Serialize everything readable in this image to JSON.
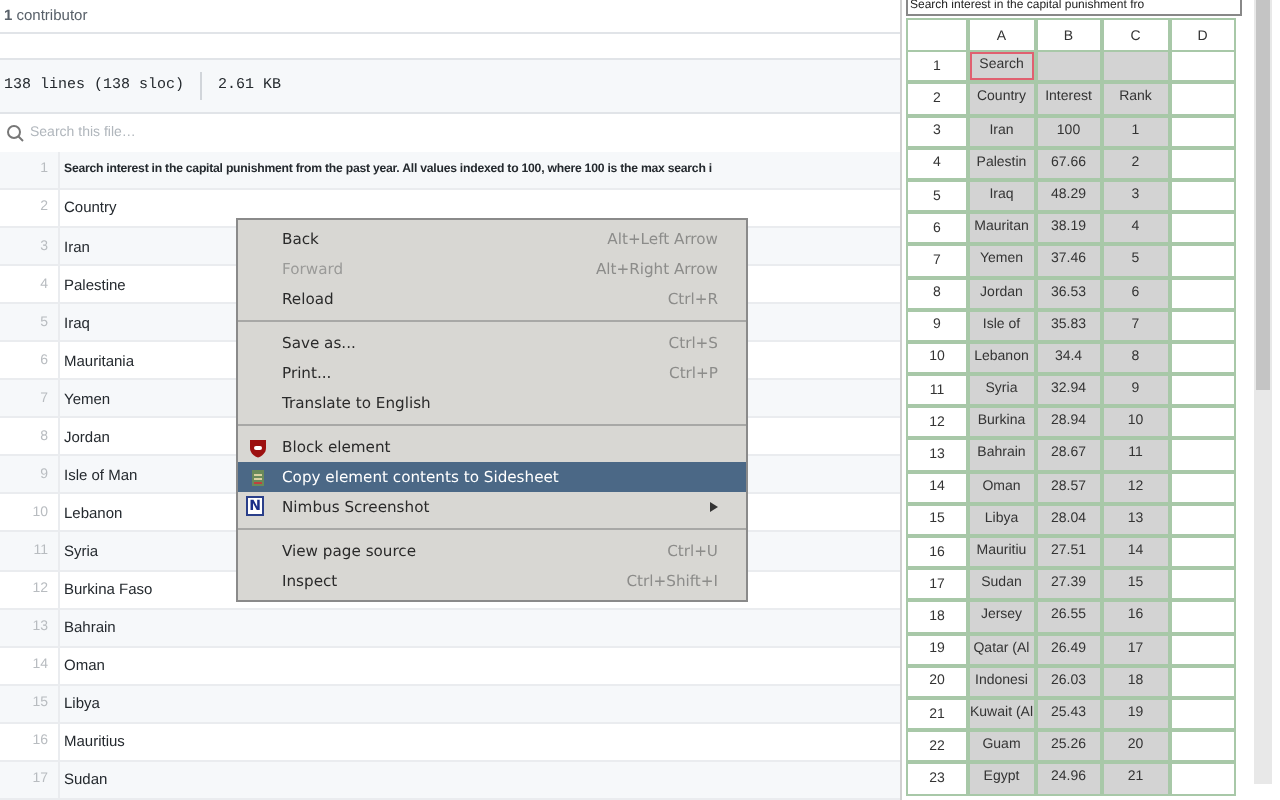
{
  "page": {
    "contributors": "**1** contributor",
    "file_info": {
      "lines": "138 lines (138 sloc)",
      "size": "2.61 KB"
    },
    "search": {
      "placeholder": "Search this file…"
    },
    "code_lines": [
      {
        "number": "1",
        "text": "Search interest in the capital punishment from the past year. All values indexed to 100, where 100 is the max search i",
        "bold": true
      },
      {
        "number": "2",
        "text": "Country",
        "bold": false
      },
      {
        "number": "3",
        "text": "Iran",
        "bold": false
      },
      {
        "number": "4",
        "text": "Palestine",
        "bold": false
      },
      {
        "number": "5",
        "text": "Iraq",
        "bold": false
      },
      {
        "number": "6",
        "text": "Mauritania",
        "bold": false
      },
      {
        "number": "7",
        "text": "Yemen",
        "bold": false
      },
      {
        "number": "8",
        "text": "Jordan",
        "bold": false
      },
      {
        "number": "9",
        "text": "Isle of Man",
        "bold": false
      },
      {
        "number": "10",
        "text": "Lebanon",
        "bold": false
      },
      {
        "number": "11",
        "text": "Syria",
        "bold": false
      },
      {
        "number": "12",
        "text": "Burkina Faso",
        "bold": false
      },
      {
        "number": "13",
        "text": "Bahrain",
        "bold": false
      },
      {
        "number": "14",
        "text": "Oman",
        "bold": false
      },
      {
        "number": "15",
        "text": "Libya",
        "bold": false
      },
      {
        "number": "16",
        "text": "Mauritius",
        "bold": false
      },
      {
        "number": "17",
        "text": "Sudan",
        "bold": false
      }
    ]
  },
  "context_menu": {
    "items": [
      {
        "kind": "item",
        "label": "Back",
        "shortcut": "Alt+Left Arrow",
        "disabled": false,
        "selected": false
      },
      {
        "kind": "item",
        "label": "Forward",
        "shortcut": "Alt+Right Arrow",
        "disabled": true,
        "selected": false
      },
      {
        "kind": "item",
        "label": "Reload",
        "shortcut": "Ctrl+R",
        "disabled": false,
        "selected": false
      },
      {
        "kind": "separator"
      },
      {
        "kind": "item",
        "label": "Save as...",
        "shortcut": "Ctrl+S",
        "disabled": false,
        "selected": false
      },
      {
        "kind": "item",
        "label": "Print...",
        "shortcut": "Ctrl+P",
        "disabled": false,
        "selected": false
      },
      {
        "kind": "item",
        "label": "Translate to English",
        "disabled": false,
        "selected": false
      },
      {
        "kind": "separator"
      },
      {
        "kind": "blocker",
        "label": "Block element",
        "disabled": false,
        "selected": false
      },
      {
        "kind": "sidesheet",
        "label": "Copy element contents to Sidesheet",
        "disabled": false,
        "selected": true
      },
      {
        "kind": "nimbus",
        "label": "Nimbus Screenshot",
        "icon_text": "N",
        "submenu": true,
        "disabled": false,
        "selected": false
      },
      {
        "kind": "separator"
      },
      {
        "kind": "item",
        "label": "View page source",
        "shortcut": "Ctrl+U",
        "disabled": false,
        "selected": false
      },
      {
        "kind": "item",
        "label": "Inspect",
        "shortcut": "Ctrl+Shift+I",
        "disabled": false,
        "selected": false
      }
    ]
  },
  "sidesheet": {
    "title": "Search interest in the capital punishment fro",
    "columns": [
      "A",
      "B",
      "C",
      "D"
    ],
    "rows": [
      {
        "number": "1",
        "cells": [
          "Search",
          "",
          ""
        ],
        "selected": true,
        "active": true
      },
      {
        "number": "2",
        "cells": [
          "Country",
          "Interest",
          "Rank"
        ],
        "selected": true,
        "active": false
      },
      {
        "number": "3",
        "cells": [
          "Iran",
          "100",
          "1"
        ],
        "selected": true,
        "active": false
      },
      {
        "number": "4",
        "cells": [
          "Palestin",
          "67.66",
          "2"
        ],
        "selected": true,
        "active": false
      },
      {
        "number": "5",
        "cells": [
          "Iraq",
          "48.29",
          "3"
        ],
        "selected": true,
        "active": false
      },
      {
        "number": "6",
        "cells": [
          "Mauritan",
          "38.19",
          "4"
        ],
        "selected": true,
        "active": false
      },
      {
        "number": "7",
        "cells": [
          "Yemen",
          "37.46",
          "5"
        ],
        "selected": true,
        "active": false
      },
      {
        "number": "8",
        "cells": [
          "Jordan",
          "36.53",
          "6"
        ],
        "selected": true,
        "active": false
      },
      {
        "number": "9",
        "cells": [
          "Isle of",
          "35.83",
          "7"
        ],
        "selected": true,
        "active": false
      },
      {
        "number": "10",
        "cells": [
          "Lebanon",
          "34.4",
          "8"
        ],
        "selected": true,
        "active": false
      },
      {
        "number": "11",
        "cells": [
          "Syria",
          "32.94",
          "9"
        ],
        "selected": true,
        "active": false
      },
      {
        "number": "12",
        "cells": [
          "Burkina",
          "28.94",
          "10"
        ],
        "selected": true,
        "active": false
      },
      {
        "number": "13",
        "cells": [
          "Bahrain",
          "28.67",
          "11"
        ],
        "selected": true,
        "active": false
      },
      {
        "number": "14",
        "cells": [
          "Oman",
          "28.57",
          "12"
        ],
        "selected": true,
        "active": false
      },
      {
        "number": "15",
        "cells": [
          "Libya",
          "28.04",
          "13"
        ],
        "selected": true,
        "active": false
      },
      {
        "number": "16",
        "cells": [
          "Mauritiu",
          "27.51",
          "14"
        ],
        "selected": true,
        "active": false
      },
      {
        "number": "17",
        "cells": [
          "Sudan",
          "27.39",
          "15"
        ],
        "selected": true,
        "active": false
      },
      {
        "number": "18",
        "cells": [
          "Jersey",
          "26.55",
          "16"
        ],
        "selected": true,
        "active": false
      },
      {
        "number": "19",
        "cells": [
          "Qatar (Al",
          "26.49",
          "17"
        ],
        "selected": true,
        "active": false
      },
      {
        "number": "20",
        "cells": [
          "Indonesi",
          "26.03",
          "18"
        ],
        "selected": true,
        "active": false
      },
      {
        "number": "21",
        "cells": [
          "Kuwait (Al",
          "25.43",
          "19"
        ],
        "selected": true,
        "active": false
      },
      {
        "number": "22",
        "cells": [
          "Guam",
          "25.26",
          "20"
        ],
        "selected": true,
        "active": false
      },
      {
        "number": "23",
        "cells": [
          "Egypt",
          "24.96",
          "21"
        ],
        "selected": true,
        "active": false
      }
    ]
  }
}
